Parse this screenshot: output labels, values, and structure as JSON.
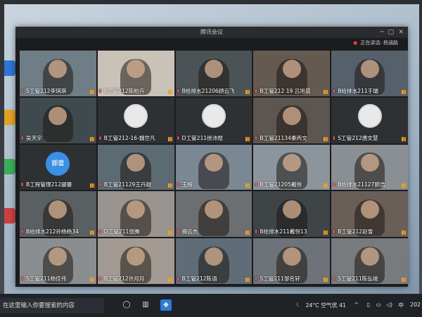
{
  "window": {
    "title": "腾讯会议",
    "speaking_label": "正在讲话: 杨涵路"
  },
  "tiles": [
    {
      "name": "S工管212李琪琪",
      "type": "video",
      "tone": "#6f7d86"
    },
    {
      "name": "B工管212陈柏卉",
      "type": "video",
      "tone": "#c9c2b8"
    },
    {
      "name": "B给排水21206顾云飞",
      "type": "video",
      "tone": "#4c5356"
    },
    {
      "name": "B工管212 19 吕旭晨",
      "type": "video",
      "tone": "#655a52"
    },
    {
      "name": "B给排水211于瑞",
      "type": "video",
      "tone": "#56606a"
    },
    {
      "name": "吴天宇",
      "type": "video",
      "tone": "#3f4a4e"
    },
    {
      "name": "B工管212-16-魏世凡",
      "type": "avatar-photo",
      "tone": "#2e3134"
    },
    {
      "name": "D工管211徐沛煜",
      "type": "avatar-photo",
      "tone": "#2e3134"
    },
    {
      "name": "B工管21134秦丙文",
      "type": "video",
      "tone": "#5d5550"
    },
    {
      "name": "S工管212唐文慧",
      "type": "avatar-photo",
      "tone": "#2e3134"
    },
    {
      "name": "B工程管理212郦蕾",
      "type": "avatar-text",
      "avatar_text": "郦蕾",
      "tone": "#2e3134"
    },
    {
      "name": "B工管21129王丹越",
      "type": "video",
      "tone": "#5c6a73"
    },
    {
      "name": "王榕",
      "type": "video",
      "tone": "#7a8894"
    },
    {
      "name": "B工管21205戴徐",
      "type": "video",
      "tone": "#8d959c"
    },
    {
      "name": "B给排水21127顾浩",
      "type": "video",
      "tone": "#8a8f93"
    },
    {
      "name": "B给排水212孙杨杨34",
      "type": "video",
      "tone": "#5a5f62"
    },
    {
      "name": "D工管211张腾",
      "type": "video",
      "tone": "#9a9490"
    },
    {
      "name": "梅云杰",
      "type": "video",
      "tone": "#6c6f71"
    },
    {
      "name": "B给排水211戴恒13",
      "type": "video",
      "tone": "#3f4447"
    },
    {
      "name": "B工管212赵雪",
      "type": "video",
      "tone": "#6a5f58"
    },
    {
      "name": "S工管211杨佳伟",
      "type": "video",
      "tone": "#8b8e90"
    },
    {
      "name": "B工管212许月月",
      "type": "video",
      "tone": "#a39b93"
    },
    {
      "name": "B工管212陈语",
      "type": "video",
      "tone": "#5e6d77"
    },
    {
      "name": "S工管211邹名轩",
      "type": "video",
      "tone": "#6d7378"
    },
    {
      "name": "S工管211陈弘竣",
      "type": "video",
      "tone": "#777b7e"
    }
  ],
  "taskbar": {
    "search_text": "在这里输入你要搜索的内容",
    "weather": "24°C 空气优 41",
    "ime": "中",
    "date_partial": "202"
  }
}
